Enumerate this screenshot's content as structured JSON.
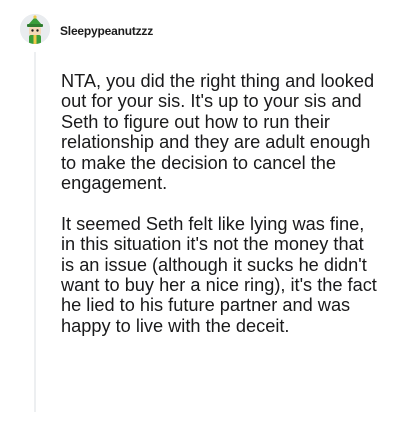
{
  "comment": {
    "author": {
      "username": "Sleepypeanutzzz",
      "avatar_icon": "snoo-avatar-green-hat-icon"
    },
    "paragraphs": [
      "NTA, you did the right thing and looked out for your sis. It's up to your sis and Seth to figure out how to run their relationship and they are adult enough to make the decision to cancel the engagement.",
      "It seemed Seth felt like lying was fine, in this situation it's not the money that is an issue (although it sucks he didn't want to buy her a nice ring), it's the fact he lied to his future partner and was happy to live with the deceit."
    ]
  },
  "colors": {
    "text": "#1a1a1b",
    "thread_line": "#edeff1",
    "avatar_hat": "#3a9d3a",
    "avatar_background": "#e9ecef"
  }
}
